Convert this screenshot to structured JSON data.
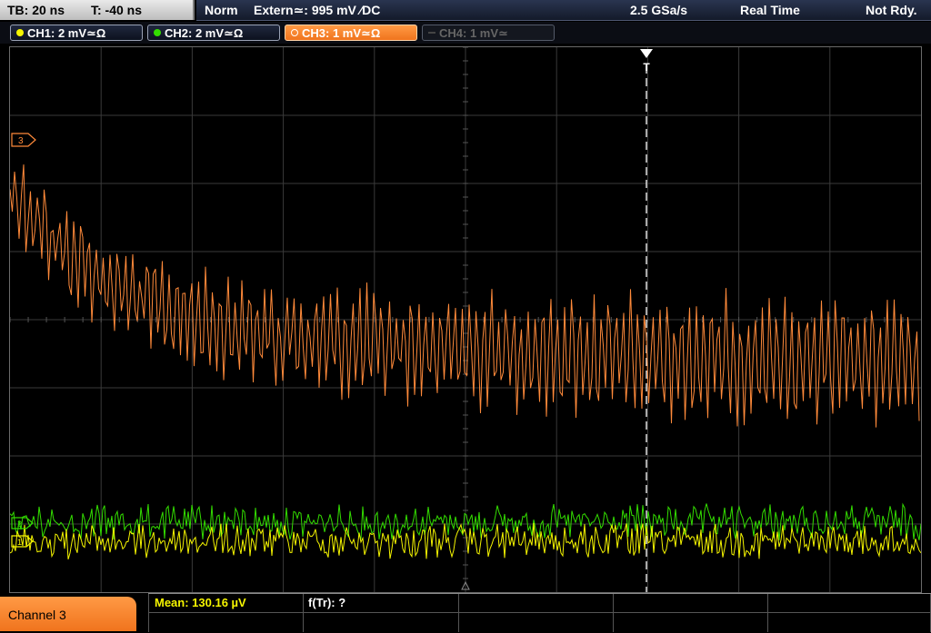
{
  "status": {
    "timebase": "TB: 20 ns",
    "trigger_time": "T: -40 ns",
    "acq_mode": "Norm",
    "trigger_source": "Extern≃: 995 mV ∕DC",
    "sample_rate": "2.5 GSa/s",
    "acq_type": "Real Time",
    "state": "Not Rdy."
  },
  "channels": [
    {
      "label": "CH1: 2 mV≃Ω",
      "color": "#f5f500",
      "state": "on"
    },
    {
      "label": "CH2: 2 mV≃Ω",
      "color": "#33dd00",
      "state": "on"
    },
    {
      "label": "CH3: 1 mV≃Ω",
      "color": "#ff7a1a",
      "state": "active"
    },
    {
      "label": "CH4: 1 mV≃",
      "color": "#555555",
      "state": "off"
    }
  ],
  "display": {
    "trigger_marker": "T",
    "ch3_marker": "3",
    "ch2_marker": "2",
    "ch1_marker": "1"
  },
  "bottom": {
    "channel_label": "Channel 3",
    "mean": "Mean: 130.16 µV",
    "ftr": "f(Tr): ?"
  },
  "colors": {
    "ch1": "#f5f500",
    "ch2": "#33dd00",
    "ch3": "#ff8a3a",
    "grid": "#3a3a3a",
    "trigger_line": "#ffffff"
  }
}
